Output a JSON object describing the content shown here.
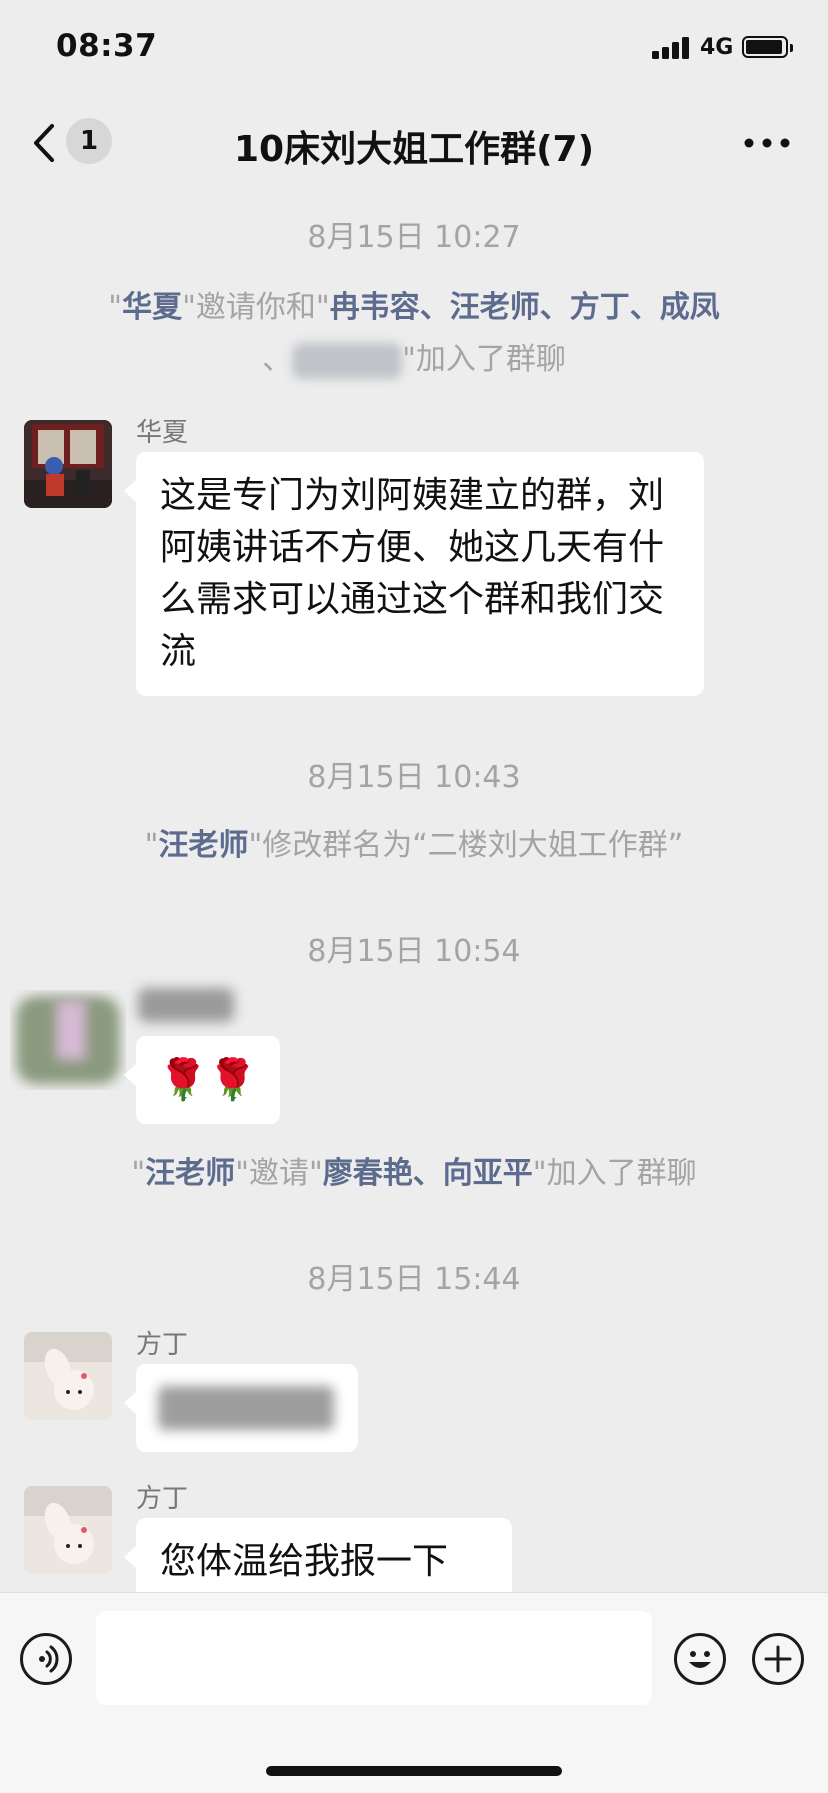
{
  "status_bar": {
    "time": "08:37",
    "network": "4G"
  },
  "nav": {
    "back_count": "1",
    "title": "10床刘大姐工作群(7)"
  },
  "timestamps": [
    "8月15日 10:27",
    "8月15日 10:43",
    "8月15日 10:54",
    "8月15日 15:44"
  ],
  "system_messages": {
    "invite1": {
      "q1": "\"",
      "inviter": "华夏",
      "q2": "\"",
      "text1": "邀请你和",
      "q3": "\"",
      "names_line1": "冉韦容、汪老师、方丁、成凤",
      "sep": "、",
      "text2": "\"加入了群聊"
    },
    "rename": {
      "q1": "\"",
      "who": "汪老师",
      "text": "\"修改群名为“二楼刘大姐工作群”"
    },
    "invite2": {
      "q1": "\"",
      "inviter": "汪老师",
      "text1": "\"邀请\"",
      "names": "廖春艳、向亚平",
      "text2": "\"加入了群聊"
    }
  },
  "messages": [
    {
      "sender": "华夏",
      "text": "这是专门为刘阿姨建立的群，刘阿姨讲话不方便、她这几天有什么需求可以通过这个群和我们交流"
    },
    {
      "sender": "",
      "text": "🌹🌹"
    },
    {
      "sender": "方丁",
      "text": ""
    },
    {
      "sender": "方丁",
      "text": "您体温给我报一下"
    }
  ],
  "icons": {
    "back": "chevron-left-icon",
    "more": "more-dots-icon",
    "voice": "voice-icon",
    "emoji": "emoji-icon",
    "plus": "plus-icon"
  }
}
